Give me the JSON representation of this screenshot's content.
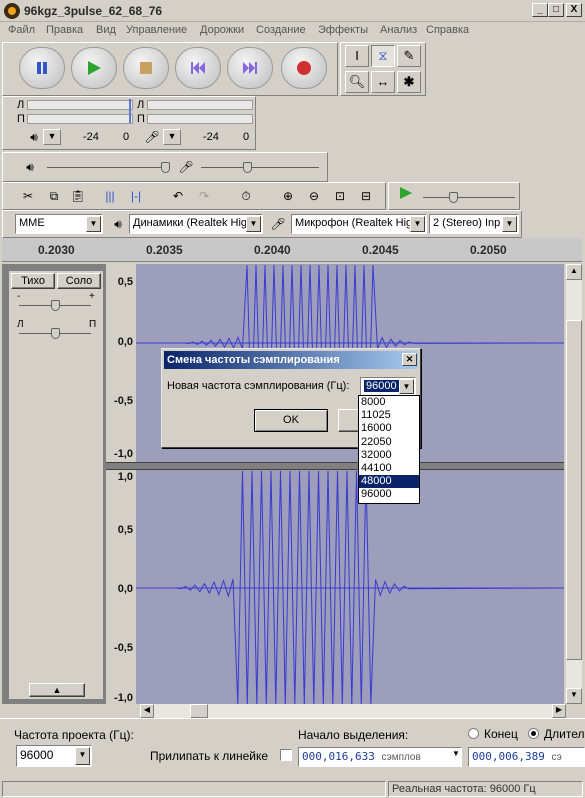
{
  "window": {
    "title": "96kgz_3pulse_62_68_76",
    "minimize": "_",
    "maximize": "□",
    "close": "X"
  },
  "menu": [
    "Файл",
    "Правка",
    "Вид",
    "Управление",
    "Дорожки",
    "Создание",
    "Эффекты",
    "Анализ",
    "Справка"
  ],
  "meter": {
    "left_label": "Л",
    "right_label": "П",
    "play_ticks": [
      "-24",
      "0"
    ],
    "rec_ticks": [
      "-24",
      "0"
    ]
  },
  "device": {
    "host": "MME",
    "output": "Динамики (Realtek High",
    "input": "Микрофон (Realtek High",
    "channels": "2 (Stereo) Inp"
  },
  "ruler": {
    "ticks": [
      "0.2030",
      "0.2035",
      "0.2040",
      "0.2045",
      "0.2050"
    ]
  },
  "track": {
    "mute": "Тихо",
    "solo": "Соло",
    "pan_left": "Л",
    "pan_right": "П",
    "gain_minus": "-",
    "gain_plus": "+"
  },
  "track1_scale": [
    "0,5",
    "0,0",
    "-0,5",
    "-1,0"
  ],
  "track2_scale": [
    "1,0",
    "0,5",
    "0,0",
    "-0,5",
    "-1,0"
  ],
  "dialog": {
    "title": "Смена частоты сэмплирования",
    "label": "Новая частота сэмплирования (Гц):",
    "value": "96000",
    "ok": "OK",
    "cancel": "Отмена",
    "options": [
      "8000",
      "11025",
      "16000",
      "22050",
      "32000",
      "44100",
      "48000",
      "96000"
    ],
    "highlighted": "48000"
  },
  "bottom": {
    "rate_label": "Частота проекта (Гц):",
    "rate_value": "96000",
    "snap_label": "Прилипать к линейке",
    "sel_start_label": "Начало выделения:",
    "end_label": "Конец",
    "length_label": "Длител",
    "sel_start_value": "000,016,633",
    "sel_start_unit": "сэмплов",
    "length_value": "000,006,389",
    "length_unit": "сэ"
  },
  "status": {
    "actual_rate": "Реальная частота: 96000 Гц"
  },
  "icons": {
    "pause": "pause-icon",
    "play": "play-icon",
    "stop": "stop-icon",
    "skip_start": "skip-start-icon",
    "skip_end": "skip-end-icon",
    "record": "record-icon"
  }
}
